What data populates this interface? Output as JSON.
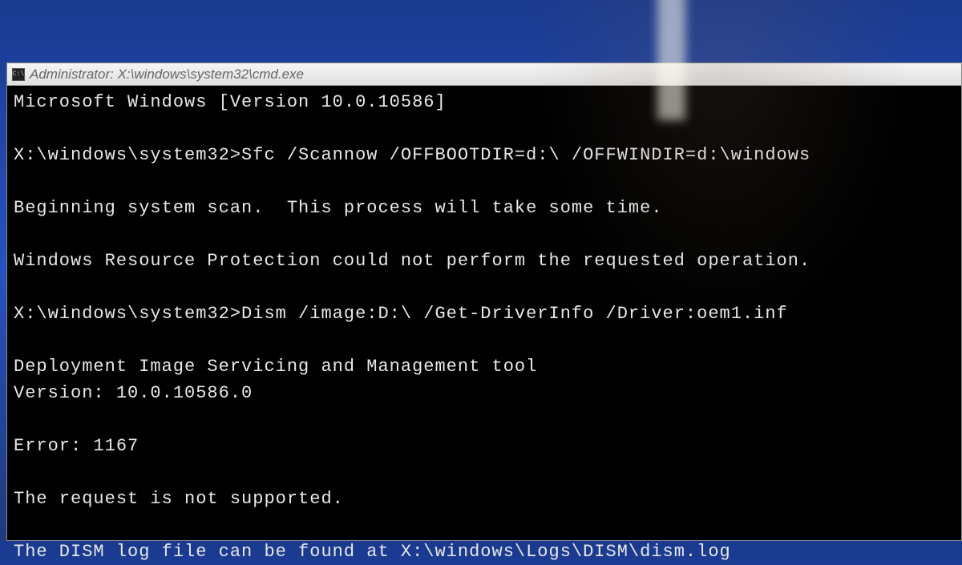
{
  "window": {
    "icon_label": "C:\\",
    "title": "Administrator: X:\\windows\\system32\\cmd.exe"
  },
  "terminal": {
    "lines": [
      "Microsoft Windows [Version 10.0.10586]",
      "",
      "X:\\windows\\system32>Sfc /Scannow /OFFBOOTDIR=d:\\ /OFFWINDIR=d:\\windows",
      "",
      "Beginning system scan.  This process will take some time.",
      "",
      "Windows Resource Protection could not perform the requested operation.",
      "",
      "X:\\windows\\system32>Dism /image:D:\\ /Get-DriverInfo /Driver:oem1.inf",
      "",
      "Deployment Image Servicing and Management tool",
      "Version: 10.0.10586.0",
      "",
      "Error: 1167",
      "",
      "The request is not supported.",
      "",
      "The DISM log file can be found at X:\\windows\\Logs\\DISM\\dism.log"
    ]
  }
}
